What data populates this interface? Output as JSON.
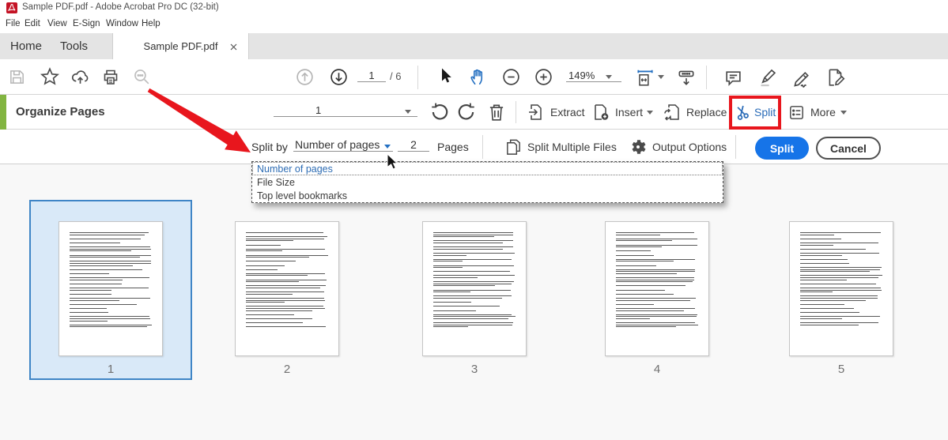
{
  "title_bar": {
    "title": "Sample PDF.pdf - Adobe Acrobat Pro DC (32-bit)"
  },
  "menu_bar": {
    "items": [
      "File",
      "Edit",
      "View",
      "E-Sign",
      "Window",
      "Help"
    ]
  },
  "tab_bar": {
    "tabs": [
      {
        "label": "Home"
      },
      {
        "label": "Tools"
      },
      {
        "label": "Sample PDF.pdf",
        "active": true
      }
    ]
  },
  "toolbar": {
    "page_current": "1",
    "page_total": "/ 6",
    "zoom_level": "149%"
  },
  "organize_bar": {
    "title": "Organize Pages",
    "range_value": "1",
    "extract_label": "Extract",
    "insert_label": "Insert",
    "replace_label": "Replace",
    "split_label": "Split",
    "more_label": "More",
    "accent_green": "#82b541"
  },
  "split_bar": {
    "split_by_label": "Split by",
    "split_by_value": "Number of pages",
    "count_value": "2",
    "unit_label": "Pages",
    "split_multiple_label": "Split Multiple Files",
    "output_options_label": "Output Options",
    "split_button": "Split",
    "cancel_button": "Cancel",
    "accent_blue": "#1674e8"
  },
  "dropdown": {
    "options": [
      {
        "label": "Number of pages",
        "selected": true
      },
      {
        "label": "File Size"
      },
      {
        "label": "Top level bookmarks"
      }
    ]
  },
  "thumbnails": {
    "pages": [
      {
        "number": "1",
        "selected": true
      },
      {
        "number": "2",
        "selected": false
      },
      {
        "number": "3",
        "selected": false
      },
      {
        "number": "4",
        "selected": false
      },
      {
        "number": "5",
        "selected": false
      }
    ]
  },
  "annotations": {
    "highlight_color": "#e8161d"
  }
}
